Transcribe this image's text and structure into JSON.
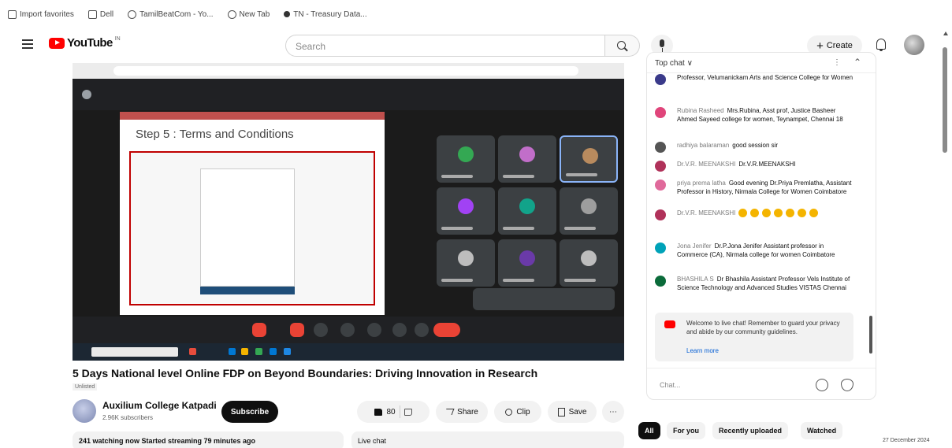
{
  "bookmarks": [
    "Import favorites",
    "Dell",
    "TamilBeatCom - Yo...",
    "New Tab",
    "TN - Treasury Data..."
  ],
  "masthead": {
    "logo_text": "YouTube",
    "logo_sup": "IN",
    "search_placeholder": "Search",
    "create_label": "Create"
  },
  "video": {
    "title": "5 Days National level Online FDP on Beyond Boundaries: Driving Innovation in Research",
    "badge": "Unlisted",
    "slide_title": "Step 5 : Terms and Conditions"
  },
  "channel": {
    "name": "Auxilium College Katpadi",
    "subscribers": "2.96K subscribers",
    "subscribe_label": "Subscribe"
  },
  "actions": {
    "likes": "80",
    "share": "Share",
    "clip": "Clip",
    "save": "Save",
    "more": "⋯"
  },
  "description": {
    "summary": "241 watching now  Started streaming 79 minutes ago"
  },
  "livechat_box": {
    "label": "Live chat"
  },
  "chat": {
    "mode": "Top chat ∨",
    "messages": [
      {
        "author": "",
        "text": "Professor, Velumanickam Arts and Science College for Women",
        "color": "#3a3a8a"
      },
      {
        "author": "Rubina Rasheed",
        "text": "Mrs.Rubina, Asst prof, Justice Basheer Ahmed Sayeed college for women, Teynampet, Chennai 18",
        "color": "#e0457b"
      },
      {
        "author": "radhiya balaraman",
        "text": "good session sir",
        "color": "#555555"
      },
      {
        "author": "Dr.V.R. MEENAKSHI",
        "text": "Dr.V.R.MEENAKSHI",
        "color": "#b0325a"
      },
      {
        "author": "priya prema latha",
        "text": "Good evening Dr.Priya Premlatha, Assistant Professor in History, Nirmala College for Women Coimbatore",
        "color": "#e06a9b"
      },
      {
        "author": "Dr.V.R. MEENAKSHI",
        "text": "",
        "emoji_count": 7,
        "color": "#b0325a"
      },
      {
        "author": "Jona Jenifer",
        "text": "Dr.P.Jona Jenifer Assistant professor in Commerce (CA), Nirmala college for women Coimbatore",
        "color": "#00a2b8"
      },
      {
        "author": "BHASHILA S",
        "text": "Dr Bhashila Assistant Professor Vels Institute of Science Technology and Advanced Studies VISTAS Chennai",
        "color": "#0b6b3a"
      }
    ],
    "welcome": "Welcome to live chat! Remember to guard your privacy and abide by our community guidelines.",
    "learn_more": "Learn more",
    "input_placeholder": "Chat..."
  },
  "chips": [
    "All",
    "For you",
    "Recently uploaded",
    "Watched"
  ],
  "taskbar_date": "27 December 2024"
}
